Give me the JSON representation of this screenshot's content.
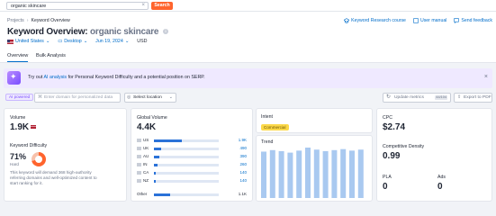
{
  "search": {
    "value": "organic skincare",
    "clear": "×",
    "button": "Search"
  },
  "breadcrumb": {
    "root": "Projects",
    "sep": "›",
    "current": "Keyword Overview"
  },
  "header_links": [
    "Keyword Research course",
    "User manual",
    "Send feedback"
  ],
  "title": {
    "prefix": "Keyword Overview:",
    "keyword": "organic skincare",
    "info": "i"
  },
  "filters": {
    "country": "United States",
    "device": "Desktop",
    "date": "Jun 19, 2024",
    "currency": "USD"
  },
  "tabs": [
    "Overview",
    "Bulk Analysis"
  ],
  "ai_banner": {
    "text_pre": "Try out ",
    "link": "AI analysis",
    "text_post": " for Personal Keyword Difficulty and a potential position on SERP.",
    "close": "×"
  },
  "toolbar": {
    "ai_badge": "AI powered",
    "domain_placeholder": "Enter domain for personalized data",
    "location": "Select location",
    "update": "Update metrics",
    "update_count": "44/104",
    "export": "Export to PDF"
  },
  "volume": {
    "label": "Volume",
    "value": "1.9K"
  },
  "kd": {
    "label": "Keyword Difficulty",
    "value": "71%",
    "level": "Hard",
    "percent": 71,
    "desc": "This keyword will demand 368 high-authority referring domains and well-optimized content to start ranking for it."
  },
  "global_volume": {
    "label": "Global Volume",
    "value": "4.4K",
    "rows": [
      {
        "cc": "US",
        "value": "1.9K",
        "share": 0.43
      },
      {
        "cc": "UK",
        "value": "490",
        "share": 0.11
      },
      {
        "cc": "AU",
        "value": "390",
        "share": 0.09
      },
      {
        "cc": "IN",
        "value": "260",
        "share": 0.06
      },
      {
        "cc": "CA",
        "value": "140",
        "share": 0.03
      },
      {
        "cc": "NZ",
        "value": "140",
        "share": 0.03
      }
    ],
    "other_label": "Other",
    "other_value": "1.1K",
    "other_share": 0.25
  },
  "intent": {
    "label": "Intent",
    "value": "Commercial"
  },
  "trend": {
    "label": "Trend",
    "values": [
      0.92,
      0.95,
      0.93,
      0.9,
      0.94,
      1.0,
      0.96,
      0.93,
      0.95,
      0.97,
      0.94,
      0.96
    ]
  },
  "cpc": {
    "label": "CPC",
    "value": "$2.74"
  },
  "competitive_density": {
    "label": "Competitive Density",
    "value": "0.99"
  },
  "pla": {
    "label": "PLA",
    "value": "0"
  },
  "ads": {
    "label": "Ads",
    "value": "0"
  },
  "colors": {
    "accent": "#006dca",
    "search_btn": "#ff642d",
    "bar": "#2a72d8",
    "intent": "#fcd94a"
  }
}
